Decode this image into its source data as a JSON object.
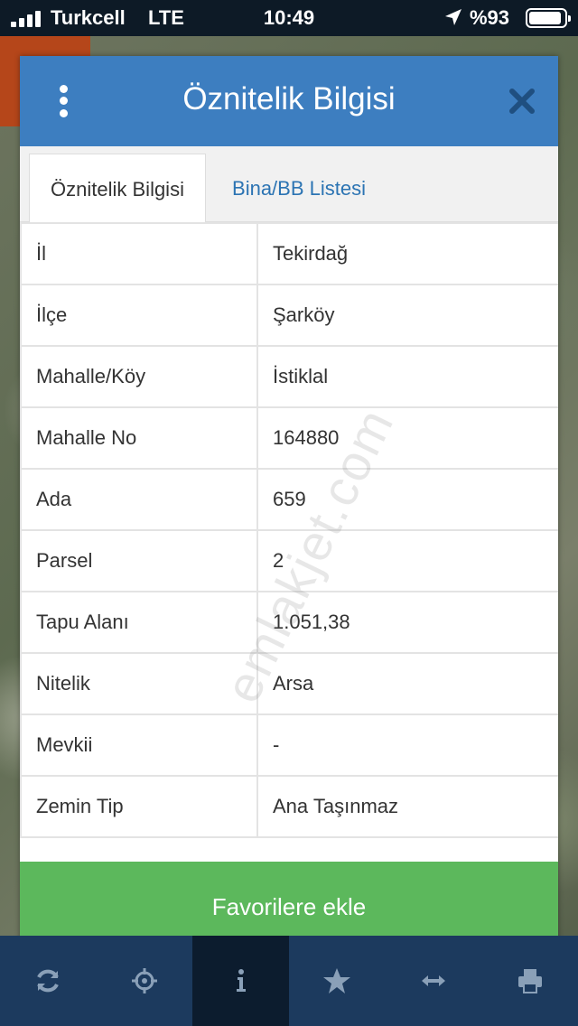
{
  "status_bar": {
    "carrier": "Turkcell",
    "network": "LTE",
    "time": "10:49",
    "battery_text": "%93",
    "battery_level": 0.93
  },
  "dialog": {
    "title": "Öznitelik Bilgisi",
    "tabs": [
      {
        "label": "Öznitelik Bilgisi",
        "active": true
      },
      {
        "label": "Bina/BB Listesi",
        "active": false
      }
    ],
    "rows": [
      {
        "key": "İl",
        "value": "Tekirdağ"
      },
      {
        "key": "İlçe",
        "value": "Şarköy"
      },
      {
        "key": "Mahalle/Köy",
        "value": "İstiklal"
      },
      {
        "key": "Mahalle No",
        "value": "164880"
      },
      {
        "key": "Ada",
        "value": "659"
      },
      {
        "key": "Parsel",
        "value": "2"
      },
      {
        "key": "Tapu Alanı",
        "value": "1.051,38"
      },
      {
        "key": "Nitelik",
        "value": "Arsa"
      },
      {
        "key": "Mevkii",
        "value": "-"
      },
      {
        "key": "Zemin Tip",
        "value": "Ana Taşınmaz"
      }
    ],
    "favorite_button": "Favorilere ekle"
  },
  "watermark": "emlakjet.com",
  "colors": {
    "header": "#3d7ec0",
    "favorite": "#5cb85c",
    "toolbar": "#1c3a5e",
    "tab_link": "#2c74b3"
  },
  "toolbar": {
    "icons": [
      "refresh-icon",
      "crosshair-icon",
      "info-icon",
      "star-icon",
      "measure-icon",
      "print-icon"
    ],
    "active_index": 2
  }
}
